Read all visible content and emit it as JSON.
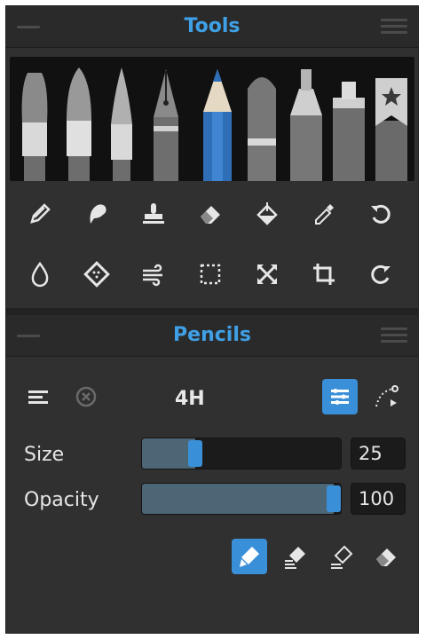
{
  "tools_panel": {
    "title": "Tools",
    "brushes": [
      "oil-brush-icon",
      "acrylic-brush-icon",
      "watercolor-brush-icon",
      "ink-pen-icon",
      "pencil-icon",
      "pastel-icon",
      "marker-icon",
      "airbrush-icon",
      "favorites-icon"
    ],
    "selected_brush": "pencil-icon",
    "row1": [
      "pencil-sketch-icon",
      "smudge-icon",
      "stamp-icon",
      "eraser-icon",
      "fill-bucket-icon",
      "eyedropper-icon",
      "undo-icon"
    ],
    "row2": [
      "blend-drop-icon",
      "texture-icon",
      "wind-icon",
      "selection-icon",
      "transform-icon",
      "crop-icon",
      "redo-icon"
    ]
  },
  "brush_panel": {
    "title": "Pencils",
    "preset_name": "4H",
    "size_label": "Size",
    "size_value": "25",
    "size_level": 0.25,
    "opacity_label": "Opacity",
    "opacity_value": "100",
    "opacity_level": 1.0,
    "accent_color": "#3a90d8",
    "mode_icons": [
      "paint-mode-icon",
      "blend-mode-icon",
      "erase-brush-icon",
      "eraser-icon"
    ],
    "selected_mode": "paint-mode-icon"
  }
}
